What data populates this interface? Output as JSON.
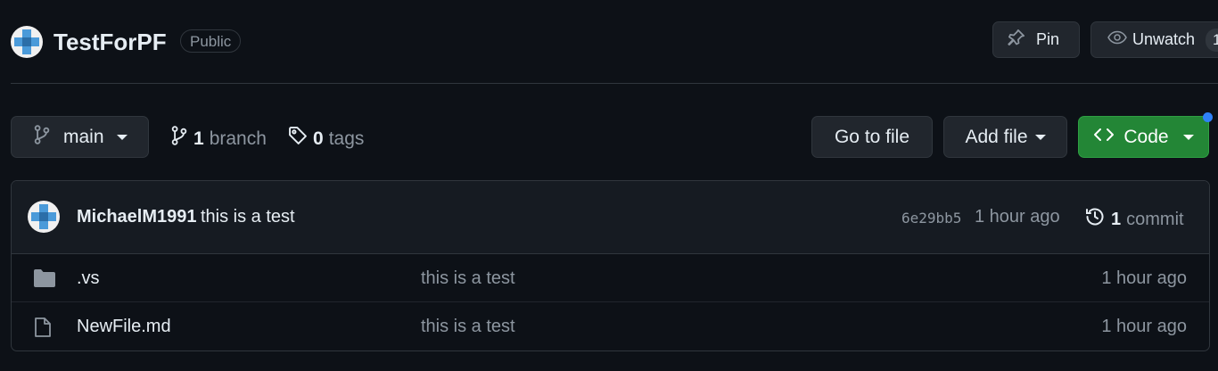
{
  "repo": {
    "name": "TestForPF",
    "visibility": "Public"
  },
  "header_actions": {
    "pin_label": "Pin",
    "watch_label": "Unwatch",
    "watch_count": "1"
  },
  "toolbar": {
    "branch_selected": "main",
    "branch_count": "1",
    "branch_word": "branch",
    "tag_count": "0",
    "tag_word": "tags",
    "go_to_file_label": "Go to file",
    "add_file_label": "Add file",
    "code_label": "Code"
  },
  "latest_commit": {
    "author": "MichaelM1991",
    "message": "this is a test",
    "sha": "6e29bb5",
    "time": "1 hour ago",
    "commit_count": "1",
    "commit_word": "commit"
  },
  "files": [
    {
      "name": ".vs",
      "type": "folder",
      "message": "this is a test",
      "age": "1 hour ago"
    },
    {
      "name": "NewFile.md",
      "type": "file",
      "message": "this is a test",
      "age": "1 hour ago"
    }
  ],
  "colors": {
    "background": "#0d1117",
    "border": "#30363d",
    "code_button": "#238636",
    "notify_dot": "#2f81f7",
    "avatar_blue": "#4a9ad9"
  },
  "icons": {
    "branch": "git-branch-icon",
    "tag": "tag-icon",
    "history": "history-icon",
    "folder": "folder-icon",
    "file": "file-icon",
    "code": "code-icon",
    "pin": "pin-icon",
    "eye": "eye-icon"
  }
}
